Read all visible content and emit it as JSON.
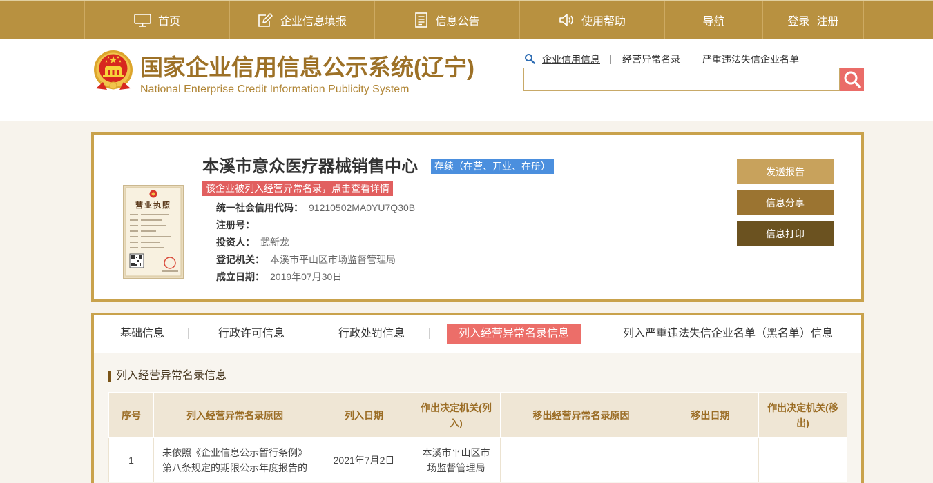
{
  "top_nav": {
    "items": [
      {
        "label": "首页",
        "icon": "monitor-icon"
      },
      {
        "label": "企业信息填报",
        "icon": "edit-icon"
      },
      {
        "label": "信息公告",
        "icon": "document-icon"
      },
      {
        "label": "使用帮助",
        "icon": "speaker-icon"
      },
      {
        "label": "导航"
      }
    ],
    "login_label": "登录",
    "register_label": "注册"
  },
  "header": {
    "emblem_icon": "national-emblem-icon",
    "title": "国家企业信用信息公示系统(辽宁)",
    "subtitle": "National Enterprise Credit Information Publicity System"
  },
  "search": {
    "icon": "search-icon",
    "tabs": [
      {
        "label": "企业信用信息",
        "active": true
      },
      {
        "label": "经营异常名录",
        "active": false
      },
      {
        "label": "严重违法失信企业名单",
        "active": false
      }
    ],
    "button_icon": "search-icon"
  },
  "company": {
    "license_thumbnail": {
      "label": "营业执照"
    },
    "name": "本溪市意众医疗器械销售中心",
    "status": "存续（在营、开业、在册）",
    "alert": "该企业被列入经营异常名录，点击查看详情",
    "fields": [
      {
        "label": "统一社会信用代码：",
        "value": "91210502MA0YU7Q30B"
      },
      {
        "label": "注册号：",
        "value": ""
      },
      {
        "label": "投资人：",
        "value": "武新龙"
      },
      {
        "label": "登记机关：",
        "value": "本溪市平山区市场监督管理局"
      },
      {
        "label": "成立日期：",
        "value": "2019年07月30日"
      }
    ],
    "actions": [
      {
        "label": "发送报告"
      },
      {
        "label": "信息分享"
      },
      {
        "label": "信息打印"
      }
    ]
  },
  "detail_tabs": [
    {
      "label": "基础信息",
      "active": false
    },
    {
      "label": "行政许可信息",
      "active": false
    },
    {
      "label": "行政处罚信息",
      "active": false
    },
    {
      "label": "列入经营异常名录信息",
      "active": true
    },
    {
      "label": "列入严重违法失信企业名单（黑名单）信息",
      "active": false
    }
  ],
  "section": {
    "title": "列入经营异常名录信息",
    "table": {
      "headers": [
        "序号",
        "列入经营异常名录原因",
        "列入日期",
        "作出决定机关(列入)",
        "移出经营异常名录原因",
        "移出日期",
        "作出决定机关(移出)"
      ],
      "rows": [
        [
          "1",
          "未依照《企业信息公示暂行条例》第八条规定的期限公示年度报告的",
          "2021年7月2日",
          "本溪市平山区市场监督管理局",
          "",
          "",
          ""
        ]
      ]
    }
  },
  "colors": {
    "nav_background": "#b89140",
    "brand_gold": "#c9a24c",
    "title_brown": "#9d7127",
    "alert_red": "#e15f5f",
    "active_tab_red": "#ec6e69",
    "search_button_red": "#ea6c68",
    "status_blue": "#4b8fde",
    "button_send": "#c8a25c",
    "button_share": "#9b7431",
    "button_print": "#6b5220",
    "table_header_bg": "#efe6d5"
  }
}
